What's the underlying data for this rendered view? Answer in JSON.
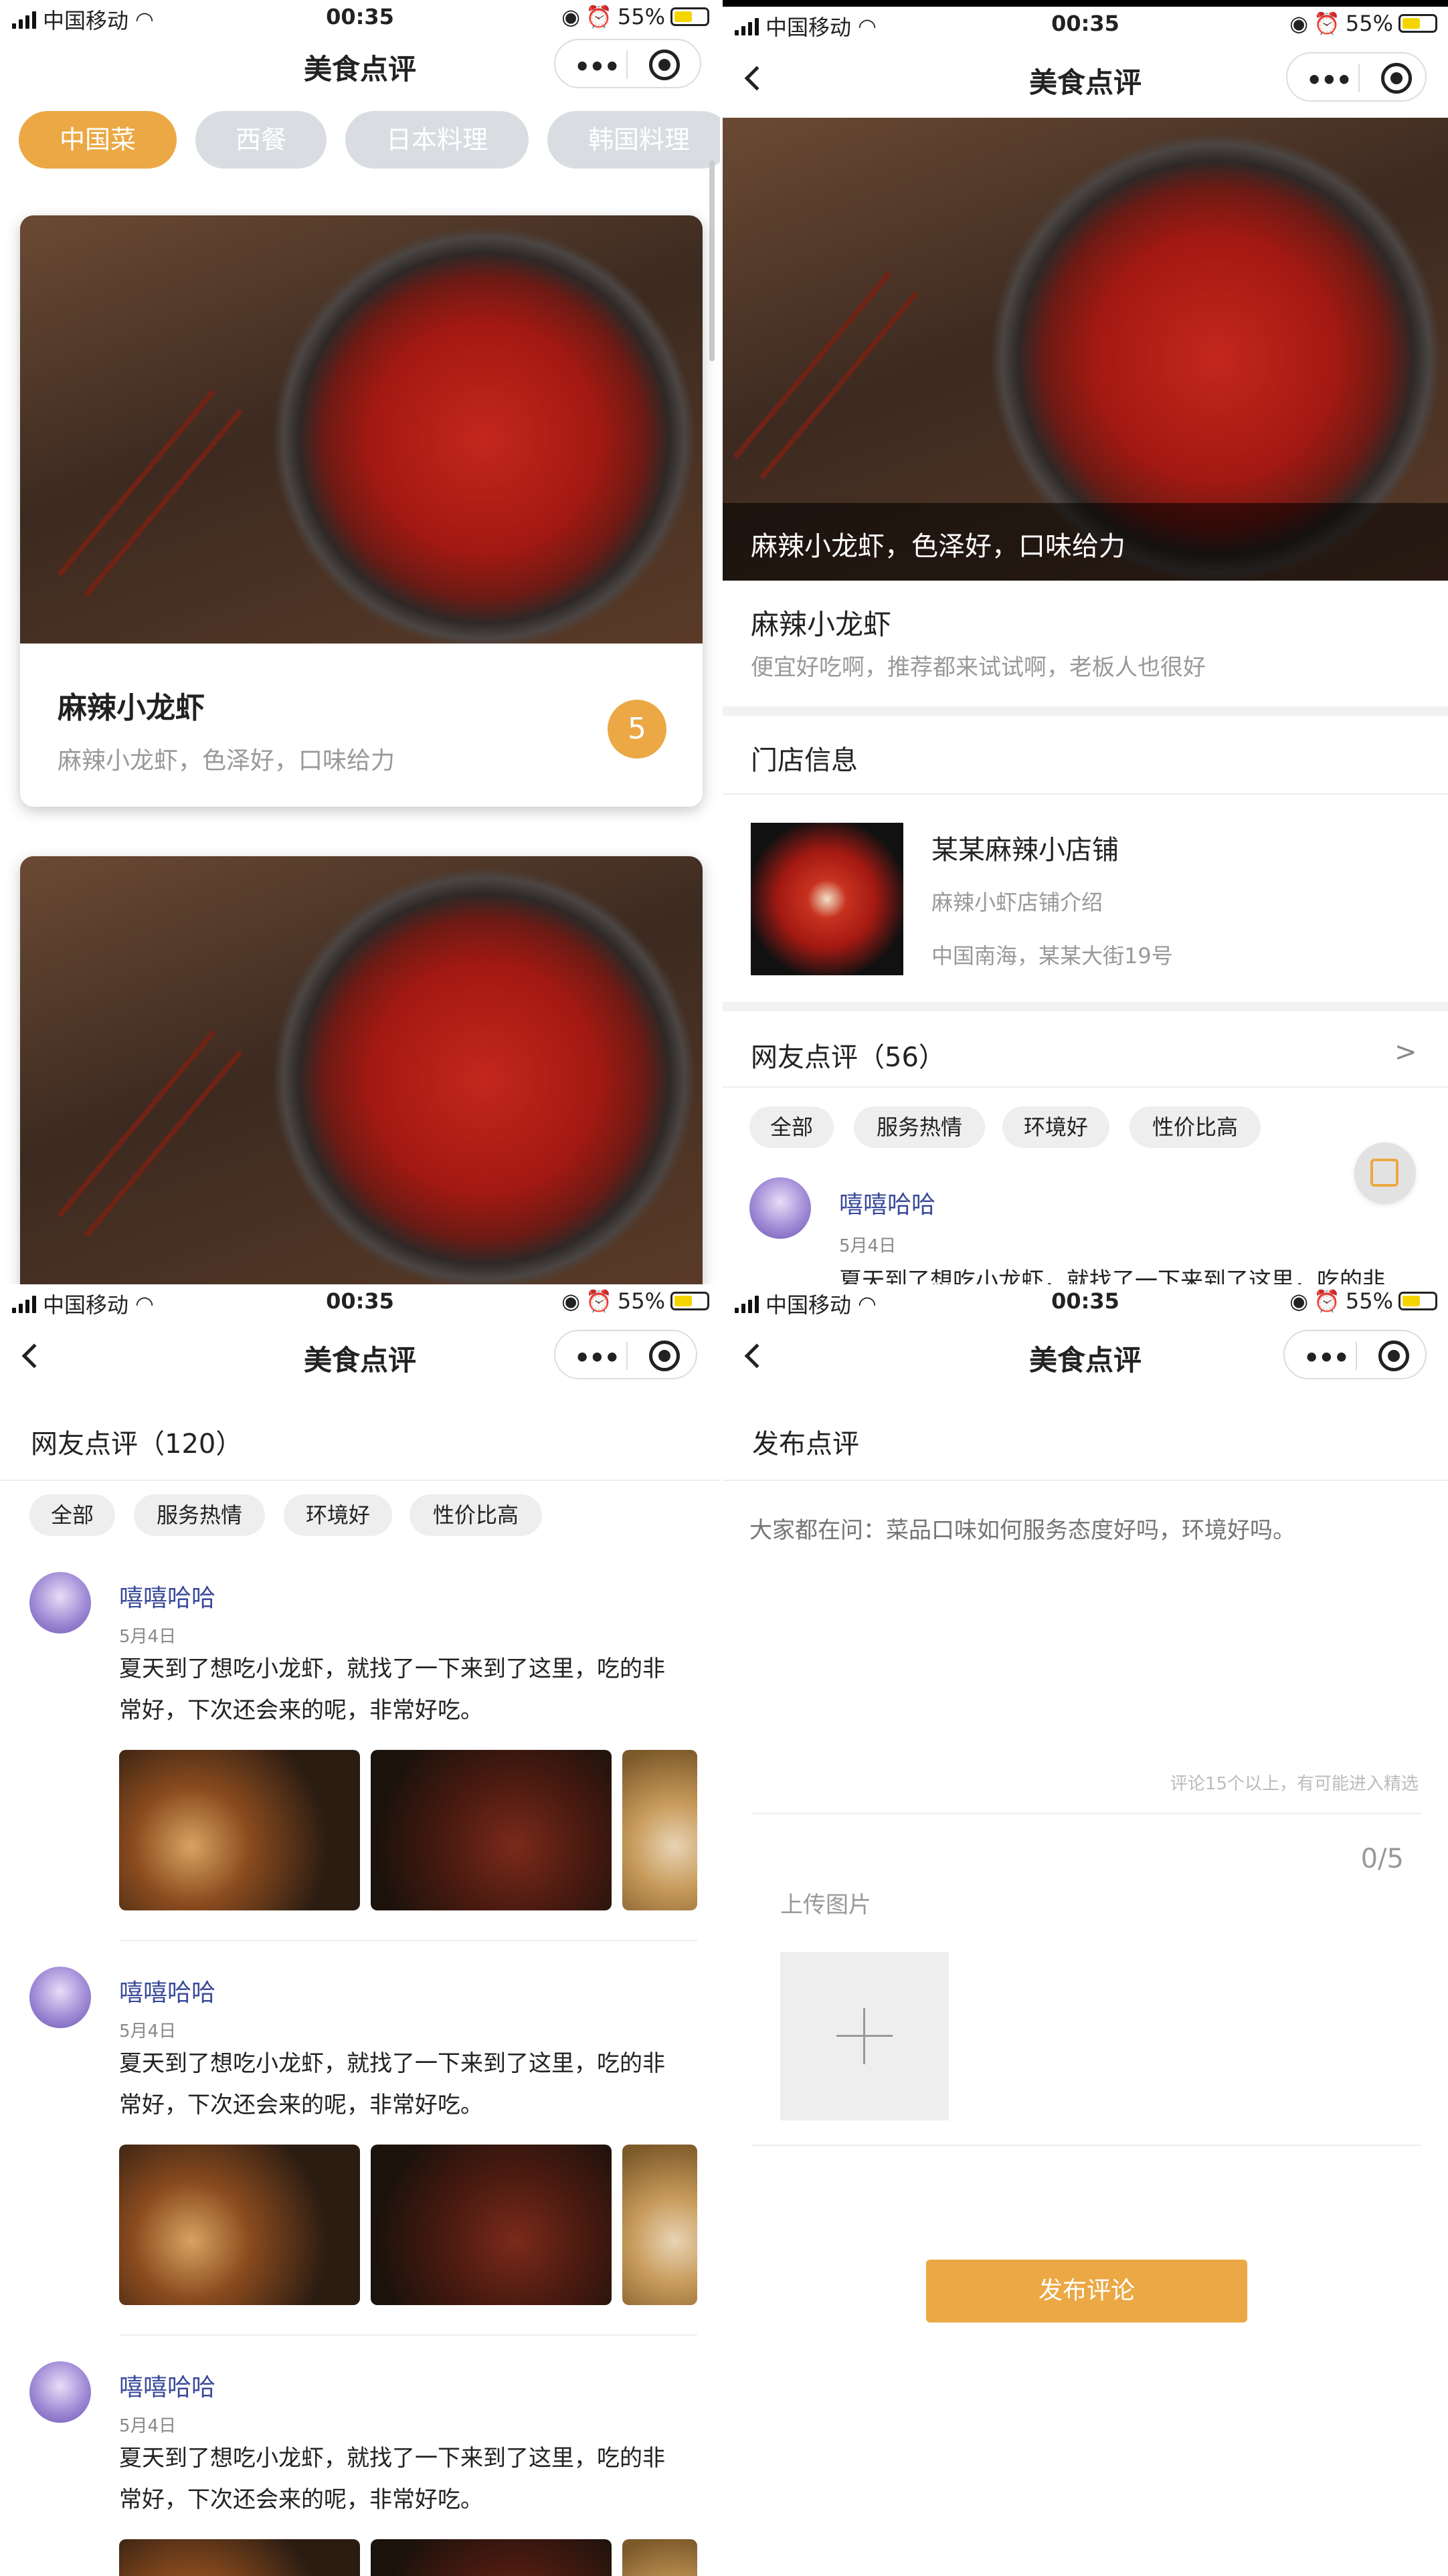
{
  "status": {
    "carrier": "中国移动",
    "time": "00:35",
    "battery": "55%"
  },
  "nav": {
    "title": "美食点评"
  },
  "home": {
    "categories": [
      "中国菜",
      "西餐",
      "日本料理",
      "韩国料理"
    ],
    "cards": [
      {
        "title": "麻辣小龙虾",
        "desc": "麻辣小龙虾，色泽好，口味给力",
        "score": "5"
      }
    ]
  },
  "detail": {
    "banner_caption": "麻辣小龙虾，色泽好，口味给力",
    "dish_name": "麻辣小龙虾",
    "dish_desc": "便宜好吃啊，推荐都来试试啊，老板人也很好",
    "store_section": "门店信息",
    "store_name": "某某麻辣小店铺",
    "store_intro": "麻辣小虾店铺介绍",
    "store_address": "中国南海，某某大街19号",
    "reviews_title": "网友点评（56）",
    "more": ">",
    "tags": [
      "全部",
      "服务热情",
      "环境好",
      "性价比高"
    ],
    "review": {
      "user": "嘻嘻哈哈",
      "date": "5月4日",
      "text": "夏天到了想吃小龙虾，就找了一下来到了这里，吃的非"
    }
  },
  "reviews": {
    "title": "网友点评（120）",
    "tags": [
      "全部",
      "服务热情",
      "环境好",
      "性价比高"
    ],
    "items": [
      {
        "user": "嘻嘻哈哈",
        "date": "5月4日",
        "line1": "夏天到了想吃小龙虾，就找了一下来到了这里，吃的非",
        "line2": "常好，下次还会来的呢，非常好吃。"
      },
      {
        "user": "嘻嘻哈哈",
        "date": "5月4日",
        "line1": "夏天到了想吃小龙虾，就找了一下来到了这里，吃的非",
        "line2": "常好，下次还会来的呢，非常好吃。"
      },
      {
        "user": "嘻嘻哈哈",
        "date": "5月4日",
        "line1": "夏天到了想吃小龙虾，就找了一下来到了这里，吃的非",
        "line2": "常好，下次还会来的呢，非常好吃。"
      }
    ]
  },
  "publish": {
    "title": "发布点评",
    "placeholder": "大家都在问：菜品口味如何服务态度好吗，环境好吗。",
    "hint": "评论15个以上，有可能进入精选",
    "count": "0/5",
    "upload_label": "上传图片",
    "submit": "发布评论"
  },
  "colors": {
    "accent": "#EBA844",
    "tag_bg": "#EEEEEE",
    "link": "#3A4A9A"
  }
}
